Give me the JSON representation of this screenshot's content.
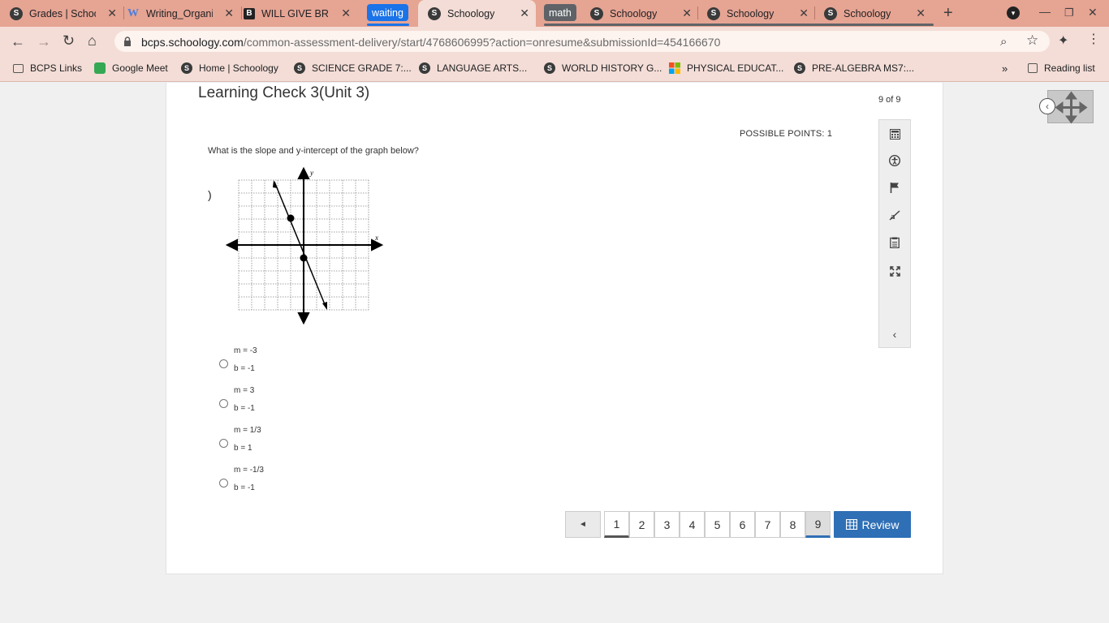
{
  "tabs": [
    {
      "title": "Grades | Schoo",
      "favicon": "schoology-icon"
    },
    {
      "title": "Writing_Organi",
      "favicon": "word-icon"
    },
    {
      "title": "WILL GIVE BRA",
      "favicon": "brainly-icon"
    },
    {
      "title": "Schoology",
      "favicon": "schoology-icon",
      "active": true
    },
    {
      "title": "Schoology",
      "favicon": "schoology-icon"
    },
    {
      "title": "Schoology",
      "favicon": "schoology-icon"
    },
    {
      "title": "Schoology",
      "favicon": "schoology-icon"
    }
  ],
  "tab_groups": [
    {
      "label": "waiting",
      "color": "#1a73e8"
    },
    {
      "label": "math",
      "color": "#5f6368"
    }
  ],
  "url": {
    "host": "bcps.schoology.com",
    "path": "/common-assessment-delivery/start/4768606995?action=onresume&submissionId=454166670"
  },
  "bookmarks": [
    "BCPS Links",
    "Google Meet",
    "Home | Schoology",
    "SCIENCE GRADE 7:...",
    "LANGUAGE ARTS...",
    "WORLD HISTORY G...",
    "PHYSICAL EDUCAT...",
    "PRE-ALGEBRA MS7:..."
  ],
  "reading_list": "Reading list",
  "assessment": {
    "title": "Learning Check 3(Unit 3)",
    "counter": "9 of 9",
    "points": "POSSIBLE POINTS: 1",
    "question": "What is the slope and y-intercept of the graph below?",
    "paren": ")",
    "graph_labels": {
      "x": "x",
      "y": "y"
    },
    "options": [
      {
        "m": "m = -3",
        "b": "b = -1"
      },
      {
        "m": "m = 3",
        "b": "b = -1"
      },
      {
        "m": "m = 1/3",
        "b": "b = 1"
      },
      {
        "m": "m = -1/3",
        "b": "b = -1"
      }
    ]
  },
  "pagination": {
    "prev": "◄",
    "pages": [
      "1",
      "2",
      "3",
      "4",
      "5",
      "6",
      "7",
      "8",
      "9"
    ],
    "current": "9",
    "review": "Review"
  },
  "colors": {
    "chrome_frame": "#e6a493",
    "toolbar": "#f3ddd6",
    "accent": "#2f6fb5"
  }
}
